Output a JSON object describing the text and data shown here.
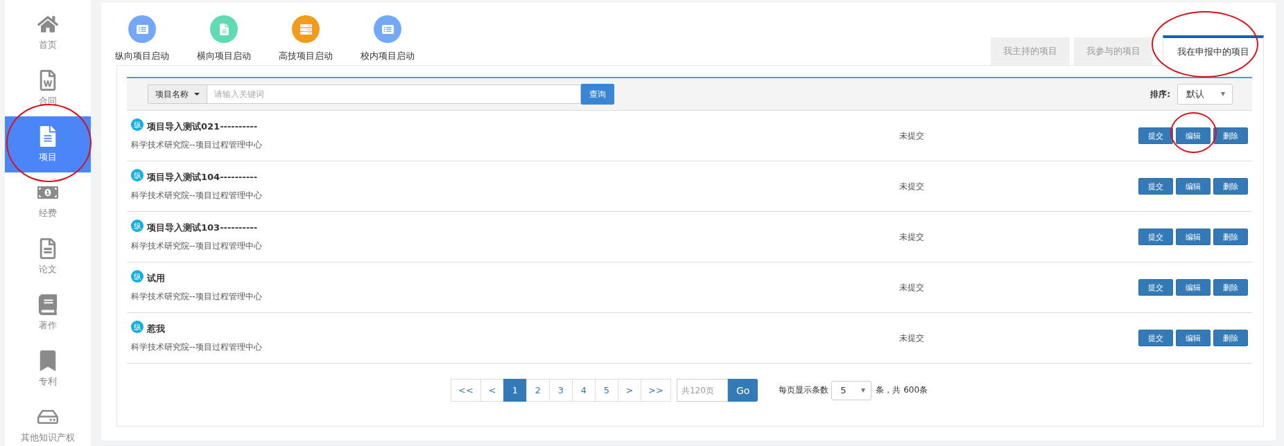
{
  "sidebar": {
    "items": [
      {
        "label": "首页",
        "selected": false,
        "circled": false
      },
      {
        "label": "合同",
        "selected": false,
        "circled": false
      },
      {
        "label": "项目",
        "selected": true,
        "circled": true
      },
      {
        "label": "经费",
        "selected": false,
        "circled": false
      },
      {
        "label": "论文",
        "selected": false,
        "circled": false
      },
      {
        "label": "著作",
        "selected": false,
        "circled": false
      },
      {
        "label": "专利",
        "selected": false,
        "circled": false
      },
      {
        "label": "其他知识产权",
        "selected": false,
        "circled": false
      }
    ]
  },
  "launchers": [
    {
      "label": "纵向项目启动",
      "color": "#72a8f6"
    },
    {
      "label": "横向项目启动",
      "color": "#5fdab2"
    },
    {
      "label": "高技项目启动",
      "color": "#f29b1c"
    },
    {
      "label": "校内项目启动",
      "color": "#72a8f6"
    }
  ],
  "tabs": [
    {
      "label": "我主持的项目",
      "selected": false,
      "circled": false
    },
    {
      "label": "我参与的项目",
      "selected": false,
      "circled": false
    },
    {
      "label": "我在申报中的项目",
      "selected": true,
      "circled": true
    }
  ],
  "search": {
    "field_menu": "项目名称",
    "placeholder": "请输入关键词",
    "button": "查询",
    "sort_label": "排序:",
    "sort_value": "默认"
  },
  "rows": [
    {
      "badge": "纵",
      "title": "项目导入测试021----------",
      "org": "科学技术研究院--项目过程管理中心",
      "status": "未提交",
      "actions": [
        {
          "label": "提交",
          "circled": false
        },
        {
          "label": "编辑",
          "circled": true
        },
        {
          "label": "删除",
          "circled": false
        }
      ]
    },
    {
      "badge": "纵",
      "title": "项目导入测试104----------",
      "org": "科学技术研究院--项目过程管理中心",
      "status": "未提交",
      "actions": [
        {
          "label": "提交",
          "circled": false
        },
        {
          "label": "编辑",
          "circled": false
        },
        {
          "label": "删除",
          "circled": false
        }
      ]
    },
    {
      "badge": "纵",
      "title": "项目导入测试103----------",
      "org": "科学技术研究院--项目过程管理中心",
      "status": "未提交",
      "actions": [
        {
          "label": "提交",
          "circled": false
        },
        {
          "label": "编辑",
          "circled": false
        },
        {
          "label": "删除",
          "circled": false
        }
      ]
    },
    {
      "badge": "纵",
      "title": "试用",
      "org": "科学技术研究院--项目过程管理中心",
      "status": "未提交",
      "actions": [
        {
          "label": "提交",
          "circled": false
        },
        {
          "label": "编辑",
          "circled": false
        },
        {
          "label": "删除",
          "circled": false
        }
      ]
    },
    {
      "badge": "纵",
      "title": "惹我",
      "org": "科学技术研究院--项目过程管理中心",
      "status": "未提交",
      "actions": [
        {
          "label": "提交",
          "circled": false
        },
        {
          "label": "编辑",
          "circled": false
        },
        {
          "label": "删除",
          "circled": false
        }
      ]
    }
  ],
  "pagination": {
    "pages": [
      {
        "label": "<<",
        "selected": false
      },
      {
        "label": "<",
        "selected": false
      },
      {
        "label": "1",
        "selected": true
      },
      {
        "label": "2",
        "selected": false
      },
      {
        "label": "3",
        "selected": false
      },
      {
        "label": "4",
        "selected": false
      },
      {
        "label": "5",
        "selected": false
      },
      {
        "label": ">",
        "selected": false
      },
      {
        "label": ">>",
        "selected": false
      }
    ],
    "page_placeholder": "共120页",
    "go": "Go",
    "per_page_label": "每页显示条数",
    "per_page": "5",
    "total": "条，共 600条"
  }
}
